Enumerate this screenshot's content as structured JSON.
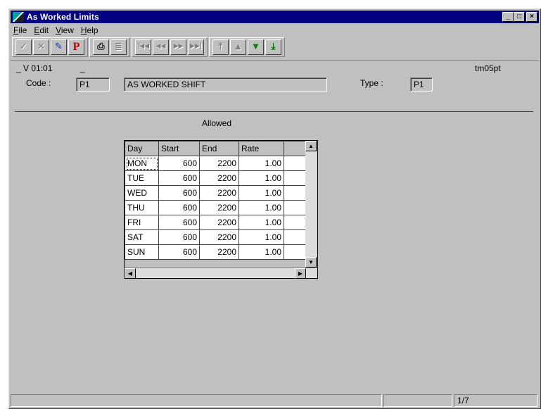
{
  "window": {
    "title": "As Worked Limits"
  },
  "window_buttons": {
    "minimize": "_",
    "maximize": "□",
    "close": "×"
  },
  "menu": [
    {
      "label": "File",
      "mnemonic": "F",
      "rest": "ile"
    },
    {
      "label": "Edit",
      "mnemonic": "E",
      "rest": "dit"
    },
    {
      "label": "View",
      "mnemonic": "V",
      "rest": "iew"
    },
    {
      "label": "Help",
      "mnemonic": "H",
      "rest": "elp"
    }
  ],
  "toolbar": {
    "accept_icon": "✓",
    "cancel_icon": "✕",
    "edit_icon": "✎",
    "print_preview_label": "P",
    "print_icon": "⎙",
    "memo_icon": "≣",
    "first_icon": "|◀◀",
    "prev_icon": "◀◀",
    "next_icon": "▶▶",
    "last_icon": "▶▶|",
    "top_icon": "⤒",
    "up_icon": "▲",
    "down_icon": "▼",
    "bottom_icon": "⤓"
  },
  "header": {
    "version": "_ V 01:01",
    "dash": "_",
    "screen_id": "tm05pt",
    "code_label": "Code :",
    "code_value": "P1",
    "description": "AS WORKED SHIFT",
    "type_label": "Type :",
    "type_value": "P1",
    "section_label": "Allowed"
  },
  "grid": {
    "columns": [
      "Day",
      "Start",
      "End",
      "Rate"
    ],
    "rows": [
      {
        "day": "MON",
        "start": "600",
        "end": "2200",
        "rate": "1.00"
      },
      {
        "day": "TUE",
        "start": "600",
        "end": "2200",
        "rate": "1.00"
      },
      {
        "day": "WED",
        "start": "600",
        "end": "2200",
        "rate": "1.00"
      },
      {
        "day": "THU",
        "start": "600",
        "end": "2200",
        "rate": "1.00"
      },
      {
        "day": "FRI",
        "start": "600",
        "end": "2200",
        "rate": "1.00"
      },
      {
        "day": "SAT",
        "start": "600",
        "end": "2200",
        "rate": "1.00"
      },
      {
        "day": "SUN",
        "start": "600",
        "end": "2200",
        "rate": "1.00"
      }
    ]
  },
  "status": {
    "record": "1/7"
  }
}
